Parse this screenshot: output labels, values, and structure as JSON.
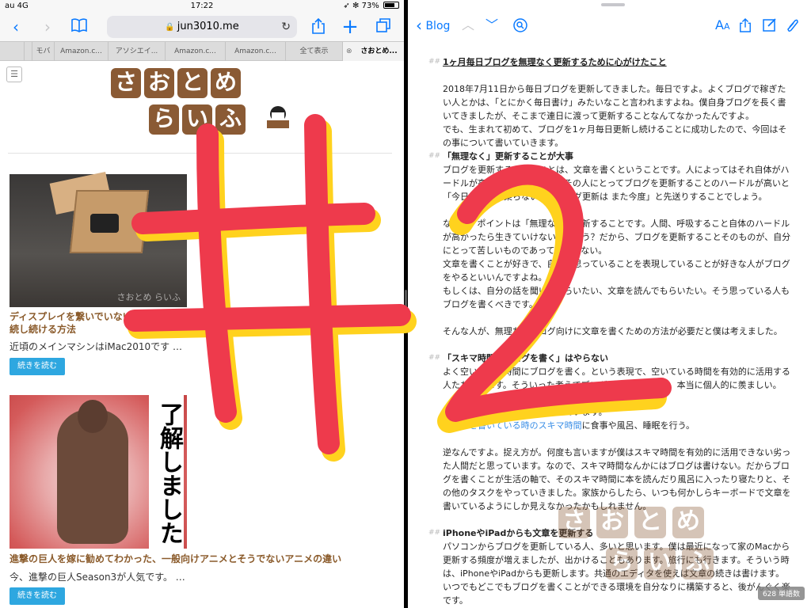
{
  "status": {
    "carrier": "au",
    "network": "4G",
    "time": "17:22",
    "battery_text": "73%",
    "battery_level": 0.73
  },
  "safari": {
    "address": "jun3010.me",
    "tabs": [
      "モバ",
      "Amazon.c...",
      "アソシエイ...",
      "Amazon.c...",
      "Amazon.c...",
      "全て表示",
      "さおとめ..."
    ],
    "icons": {
      "back": "chevron-left-icon",
      "forward": "chevron-right-icon",
      "bookmarks": "book-icon",
      "share": "share-icon",
      "new_tab": "plus-icon",
      "tabs": "tabs-icon"
    }
  },
  "site": {
    "logo_line1": [
      "さ",
      "お",
      "と",
      "め"
    ],
    "logo_line2": [
      "ら",
      "い",
      "ふ"
    ],
    "menu_icon": "menu-icon",
    "posts": [
      {
        "title": "ディスプレイを繋いでいないMacをリモートデスクトップで接続し続ける方法",
        "title_visible_line1": "ディスプレイを繋いでいない",
        "title_visible_line2": "続し続ける方法",
        "excerpt": "近頃のメインマシンはiMac2010です …",
        "button": "続きを読む",
        "watermark": "さおとめ らいふ"
      },
      {
        "title": "進撃の巨人を嫁に勧めてわかった、一般向けアニメとそうでないアニメの違い",
        "excerpt": "今、進撃の巨人Season3が人気です。 …",
        "button": "続きを読む",
        "image_text": "了解しました"
      }
    ]
  },
  "editor": {
    "back_label": "Blog",
    "icons": [
      "chevron-up-icon",
      "chevron-down-icon",
      "search-icon",
      "font-size-icon",
      "share-icon",
      "compose-icon",
      "attachment-icon"
    ],
    "heading_mark": "##",
    "lines": [
      {
        "type": "title",
        "text": "1ヶ月毎日ブログを無理なく更新するために心がけたこと"
      },
      {
        "type": "gap"
      },
      {
        "type": "p",
        "text": "2018年7月11日から毎日ブログを更新してきました。毎日ですよ。よくブログで稼ぎたい人とかは、「とにかく毎日書け」みたいなこと言われますよね。僕自身ブログを長く書いてきましたが、そこまで連日に渡って更新することなんてなかったんですよ。"
      },
      {
        "type": "p",
        "text": "でも、生まれて初めて、ブログを1ヶ月毎日更新し続けることに成功したので、今回はその事について書いていきます。"
      },
      {
        "type": "h",
        "text": "「無理なく」更新することが大事"
      },
      {
        "type": "p",
        "text": "ブログを更新するということは、文章を書くということです。人によってはそれ自体がハードルが高いと感じています。その人にとってブログを更新することのハードルが高いと「今日は気分が乗らないからブログ更新は また今度」と先送りすることでしょう。"
      },
      {
        "type": "gap"
      },
      {
        "type": "p",
        "text": "なので、ポイントは「無理なく」更新することです。人間、呼吸すること自体のハードルが高かったら生きていけないでしょう？だから、ブログを更新することそのものが、自分にとって苦しいものであってはいけない。"
      },
      {
        "type": "p",
        "text": "文章を書くことが好きで、自分の思っていることを表現していることが好きな人がブログをやるといいんですよね。"
      },
      {
        "type": "p",
        "text": "もしくは、自分の話を聞いてもらいたい、文章を読んでもらいたい。そう思っている人もブログを書くべきです。"
      },
      {
        "type": "gap"
      },
      {
        "type": "p",
        "text": "そんな人が、無理なくブログ向けに文章を書くための方法が必要だと僕は考えました。"
      },
      {
        "type": "gap"
      },
      {
        "type": "h",
        "text": "「スキマ時間にブログを書く」はやらない"
      },
      {
        "type": "p",
        "text": "よく空いている時間にブログを書く。という表現で、空いている時間を有効的に活用する人たちがいます。そういった考えでブログが書けることは、本当に個人的に羨ましい。"
      },
      {
        "type": "gap"
      },
      {
        "type": "p",
        "text": "僕は逆の考え方でブログを書いています。"
      },
      {
        "type": "link",
        "text": "ブログを書いている時のスキマ時間",
        "after": "に食事や風呂、睡眠を行う。"
      },
      {
        "type": "gap"
      },
      {
        "type": "p",
        "text": "逆なんですよ。捉え方が。何度も言いますが僕はスキマ時間を有効的に活用できない劣った人間だと思っています。なので、スキマ時間なんかにはブログは書けない。だからブログを書くことが生活の軸で、そのスキマ時間に本を読んだり風呂に入ったり寝たりと、その他のタスクをやっていきました。家族からしたら、いつも何かしらキーボードで文章を書いているようにしか見えなかったかもしれません。"
      },
      {
        "type": "gap"
      },
      {
        "type": "h",
        "text": "iPhoneやiPadからも文章を更新する"
      },
      {
        "type": "p",
        "text": "パソコンからブログを更新している人、多いと思います。僕は最近になって家のMacから更新する頻度が増えましたが、出かけることもあります。旅行にも行きます。そういう時は、iPhoneやiPadからも更新します。共通のエディタを使えば文章の続きは書けます。いつでもどこでもブログを書くことができる環境を自分なりに構築すると、後がんぐく楽です。"
      }
    ],
    "word_count": "628 単語数"
  },
  "overlay": {
    "glyph1": "#",
    "glyph2": "2",
    "colors": {
      "red": "#ee3a4c",
      "yellow": "#ffd21e"
    }
  }
}
